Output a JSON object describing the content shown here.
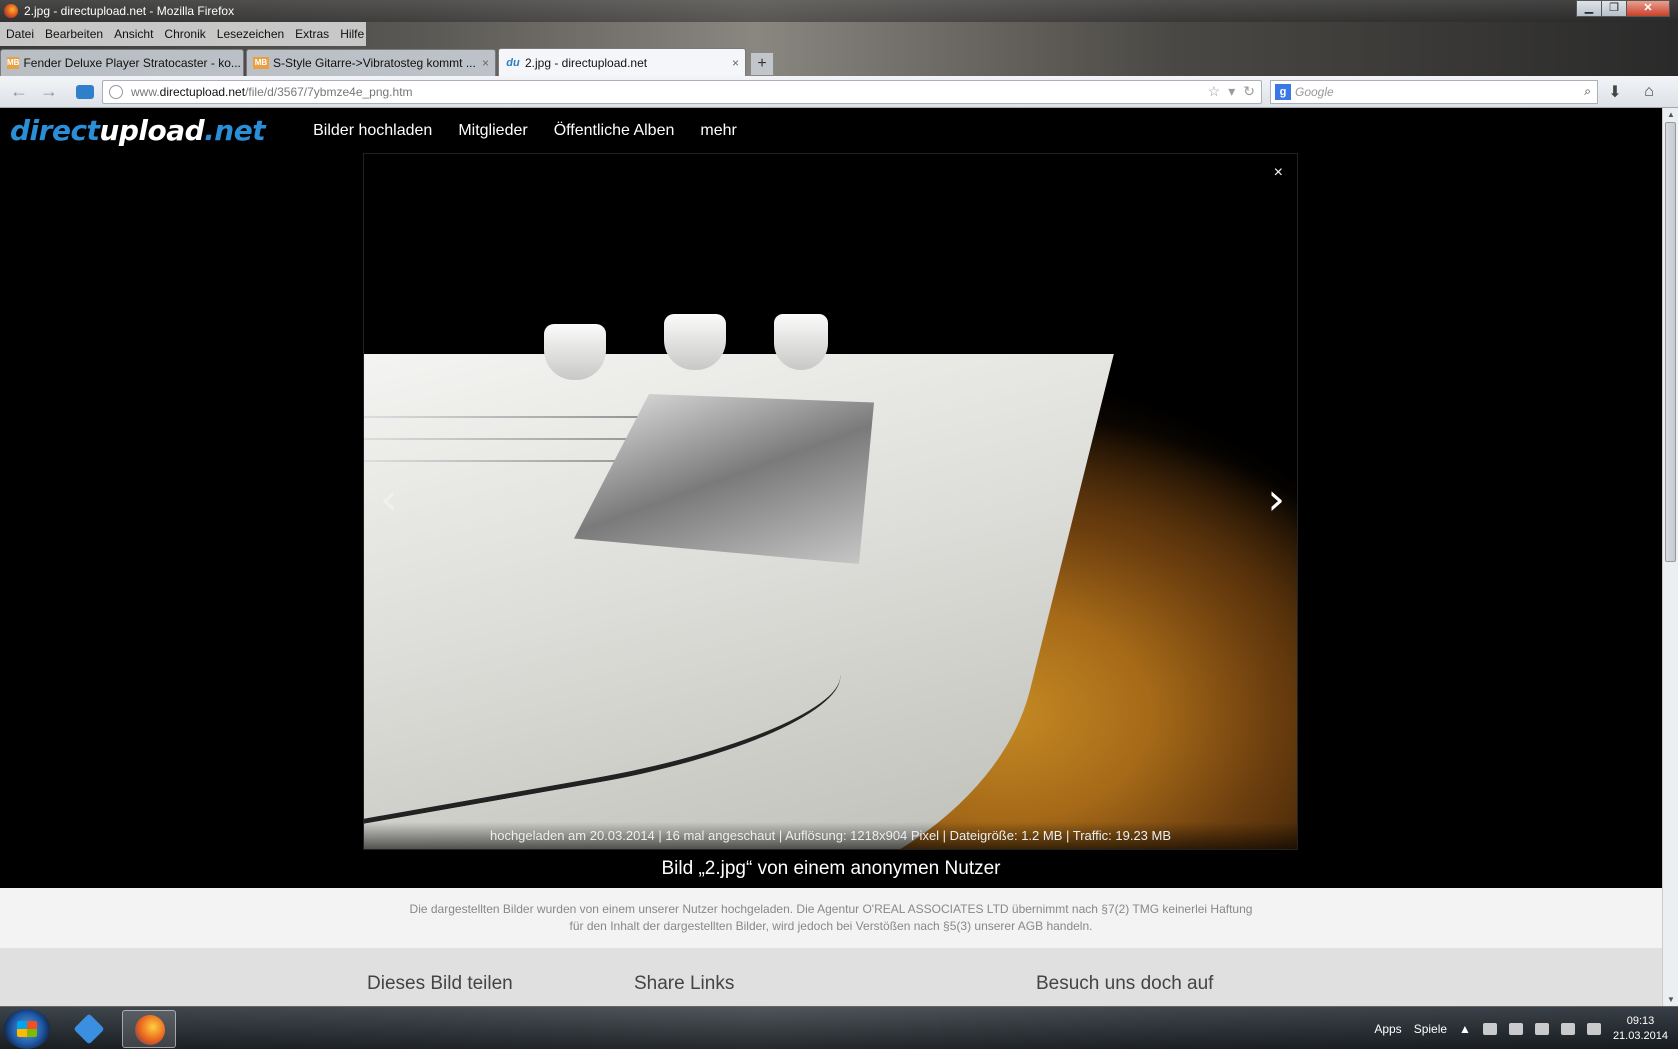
{
  "window": {
    "title": "2.jpg - directupload.net - Mozilla Firefox",
    "controls": {
      "minimize": "▁",
      "restore": "❐",
      "close": "✕"
    }
  },
  "menubar": [
    {
      "label": "Datei"
    },
    {
      "label": "Bearbeiten"
    },
    {
      "label": "Ansicht"
    },
    {
      "label": "Chronik"
    },
    {
      "label": "Lesezeichen"
    },
    {
      "label": "Extras"
    },
    {
      "label": "Hilfe"
    }
  ],
  "tabs": [
    {
      "label": "Fender Deluxe Player Stratocaster - ko...",
      "favicon": "MB"
    },
    {
      "label": "S-Style Gitarre->Vibratosteg kommt ...",
      "favicon": "MB"
    },
    {
      "label": "2.jpg - directupload.net",
      "favicon": "du"
    }
  ],
  "new_tab": "+",
  "url": {
    "prefix": "www.",
    "domain": "directupload.net",
    "path": "/file/d/3567/7ybmze4e_png.htm"
  },
  "search": {
    "engine": "g",
    "placeholder": "Google"
  },
  "site": {
    "logo_a": "direct",
    "logo_b": "upload",
    "logo_c": ".net",
    "nav": [
      "Bilder hochladen",
      "Mitglieder",
      "Öffentliche Alben",
      "mehr"
    ]
  },
  "lightbox": {
    "close": "×",
    "prev": "‹",
    "next": "›",
    "meta": "hochgeladen am 20.03.2014 | 16 mal angeschaut | Auflösung: 1218x904 Pixel | Dateigröße: 1.2 MB | Traffic: 19.23 MB"
  },
  "caption": "Bild „2.jpg“ von einem anonymen Nutzer",
  "disclaimer": {
    "line1": "Die dargestellten Bilder wurden von einem unserer Nutzer hochgeladen. Die Agentur O'REAL ASSOCIATES LTD übernimmt nach §7(2) TMG keinerlei Haftung",
    "line2": "für den Inhalt der dargestellten Bilder, wird jedoch bei Verstößen nach §5(3) unserer AGB handeln."
  },
  "footer": {
    "share_title": "Dieses Bild teilen",
    "links_title": "Share Links",
    "visit_title": "Besuch uns doch auf"
  },
  "taskbar": {
    "toolbar1": "Apps",
    "toolbar2": "Spiele",
    "time": "09:13",
    "date": "21.03.2014"
  },
  "colors": {
    "brand": "#2b8fd8",
    "page_bg": "#000000"
  }
}
